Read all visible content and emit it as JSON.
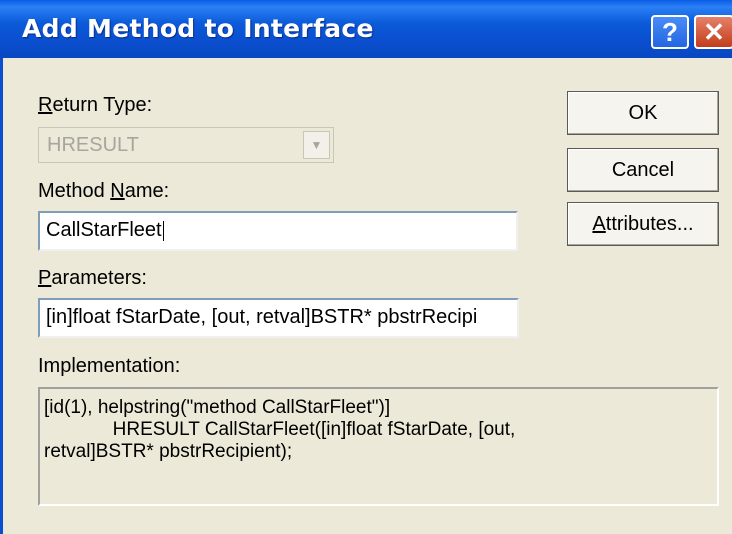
{
  "dialog": {
    "title": "Add Method to Interface",
    "help_glyph": "?",
    "close_glyph": "✕"
  },
  "return_type": {
    "label_first": "R",
    "label_rest": "eturn Type:",
    "value": "HRESULT",
    "enabled": false
  },
  "method_name": {
    "label_pre": "Method ",
    "label_acc": "N",
    "label_post": "ame:",
    "value": "CallStarFleet"
  },
  "parameters": {
    "label_first": "P",
    "label_rest": "arameters:",
    "value": "[in]float fStarDate, [out, retval]BSTR* pbstrRecipi"
  },
  "implementation": {
    "label": "Implementation:",
    "lines": [
      "[id(1), helpstring(\"method CallStarFleet\")]",
      "             HRESULT CallStarFleet([in]float fStarDate, [out,",
      "retval]BSTR* pbstrRecipient);"
    ]
  },
  "buttons": {
    "ok": "OK",
    "cancel": "Cancel",
    "attributes_first": "A",
    "attributes_rest": "ttributes..."
  }
}
